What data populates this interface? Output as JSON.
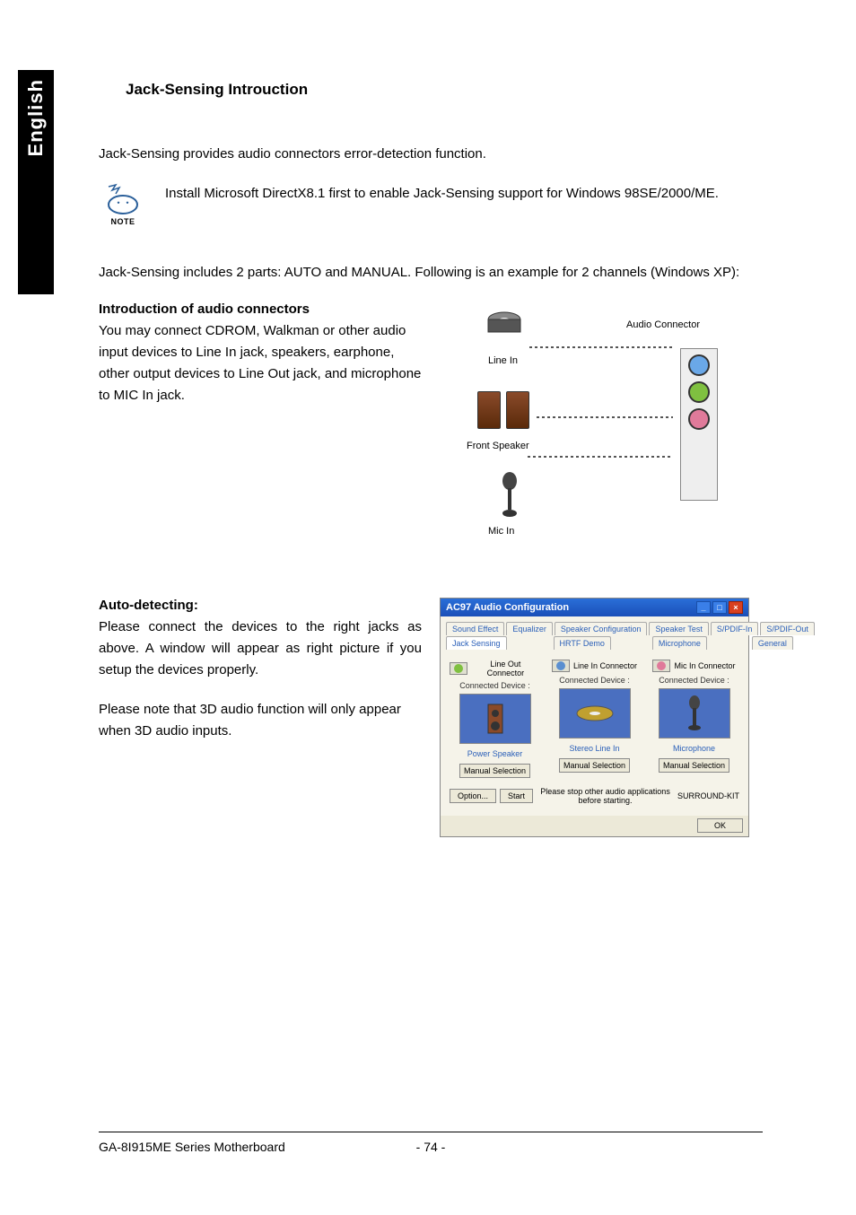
{
  "language_tab": "English",
  "section_title": "Jack-Sensing Introuction",
  "intro_para": "Jack-Sensing provides audio connectors error-detection function.",
  "note_label": "NOTE",
  "note_text": "Install Microsoft DirectX8.1 first to enable Jack-Sensing support for Windows 98SE/2000/ME.",
  "parts_para": "Jack-Sensing includes 2 parts: AUTO and MANUAL. Following is an example for 2 channels (Windows XP):",
  "intro_connectors": {
    "heading": "Introduction of audio connectors",
    "body": "You may connect CDROM, Walkman or other audio input devices to Line In jack, speakers, earphone, other output devices to Line Out jack, and microphone to MIC In jack."
  },
  "diagram": {
    "audio_connector": "Audio Connector",
    "line_in": "Line In",
    "front_speaker": "Front Speaker",
    "mic_in": "Mic In"
  },
  "auto_detect": {
    "heading": "Auto-detecting:",
    "body1": "Please connect the devices to the right jacks as above. A window will appear as right picture if you setup the devices properly.",
    "body2": "Please note that 3D audio function will only appear when 3D audio inputs."
  },
  "ac97": {
    "title": "AC97 Audio Configuration",
    "tabs_top": [
      "Sound Effect",
      "Equalizer",
      "Speaker Configuration",
      "Speaker Test",
      "S/PDIF-In",
      "S/PDIF-Out"
    ],
    "tabs_bottom": [
      "Jack Sensing",
      "HRTF Demo",
      "Microphone",
      "General"
    ],
    "cols": [
      {
        "jack_name": "Line Out Connector",
        "jack_color": "#7fc040",
        "device_name": "Power Speaker"
      },
      {
        "jack_name": "Line In Connector",
        "jack_color": "#5a8fd0",
        "device_name": "Stereo Line In"
      },
      {
        "jack_name": "Mic In Connector",
        "jack_color": "#e07a9a",
        "device_name": "Microphone"
      }
    ],
    "connected_device": "Connected Device :",
    "manual_selection": "Manual Selection",
    "option_btn": "Option...",
    "start_btn": "Start",
    "bottom_msg": "Please stop other audio applications before starting.",
    "surround_kit": "SURROUND-KIT",
    "ok": "OK"
  },
  "footer": {
    "product": "GA-8I915ME Series Motherboard",
    "page": "- 74 -"
  }
}
